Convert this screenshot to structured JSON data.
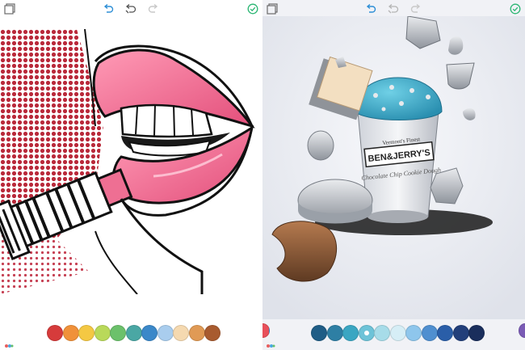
{
  "toolbar_left": {
    "icons": [
      "gallery-icon",
      "undo-icon",
      "history-icon",
      "redo-icon",
      "done-icon"
    ]
  },
  "toolbar_right": {
    "icons": [
      "gallery-icon",
      "undo-icon",
      "history-icon",
      "redo-icon",
      "done-icon"
    ]
  },
  "left_artwork": {
    "subject": "pop-art lips with lipstick"
  },
  "right_artwork": {
    "carton_brand": "BEN&JERRY'S",
    "carton_tagline": "Vermont's Finest",
    "carton_flavor": "Chocolate Chip Cookie Dough"
  },
  "colors": {
    "accent": "#2e8fd6",
    "done_green": "#2bb673",
    "lip_pink": "#ee6f93",
    "ice_cream_blue": "#3aa6c2",
    "halftone_red": "#b9293a"
  },
  "palette_left": [
    "#d63b3b",
    "#f0913a",
    "#f4c843",
    "#b9d95a",
    "#6cc16b",
    "#4aa7a4",
    "#3b88c9",
    "#a9cdee",
    "#f5d9b0",
    "#e09a55",
    "#a85b2f"
  ],
  "palette_right": [
    "#1f5d86",
    "#2e7fa4",
    "#3aa6c2",
    "#6dc3d8",
    "#a7dce9",
    "#d6eef6",
    "#8ec6ec",
    "#4f8fd0",
    "#2a5ea8",
    "#223f7a",
    "#1a2e5c"
  ],
  "palette_right_selected_index": 3
}
